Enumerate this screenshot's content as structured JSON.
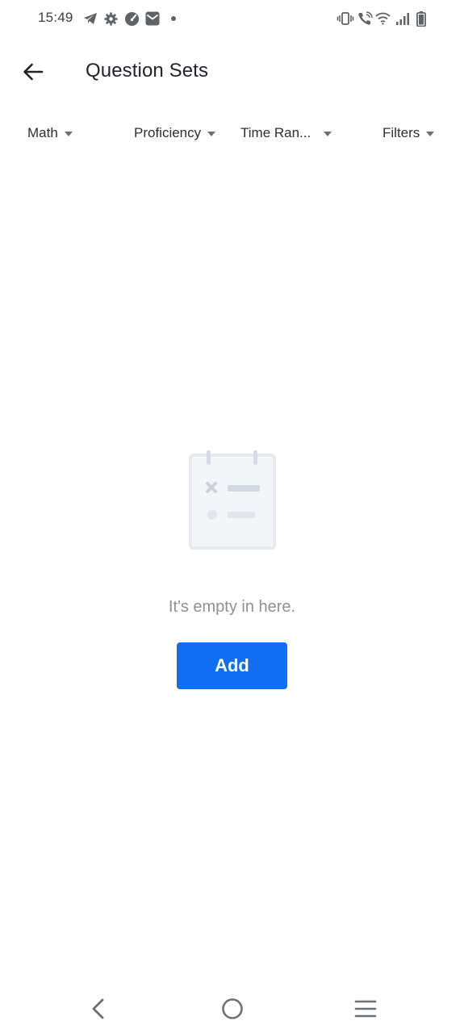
{
  "status_bar": {
    "time": "15:49",
    "left_icons": [
      "telegram-icon",
      "gear-icon",
      "speedometer-icon",
      "mail-icon",
      "dot-icon"
    ],
    "right_icons": [
      "vibrate-icon",
      "wifi-call-icon",
      "wifi-icon",
      "signal-icon",
      "battery-icon"
    ]
  },
  "header": {
    "title": "Question Sets",
    "back_icon": "arrow-left-icon"
  },
  "filters": [
    {
      "label": "Math"
    },
    {
      "label": "Proficiency"
    },
    {
      "label": "Time Ran..."
    },
    {
      "label": "Filters"
    }
  ],
  "empty_state": {
    "illustration": "empty-clipboard-icon",
    "message": "It's empty in here.",
    "button_label": "Add"
  },
  "nav_bar": {
    "icons": [
      "nav-back-icon",
      "nav-home-icon",
      "nav-menu-icon"
    ]
  },
  "colors": {
    "accent": "#0f6ff0",
    "illustration": "#e9edf3",
    "text_muted": "#8c9196"
  }
}
